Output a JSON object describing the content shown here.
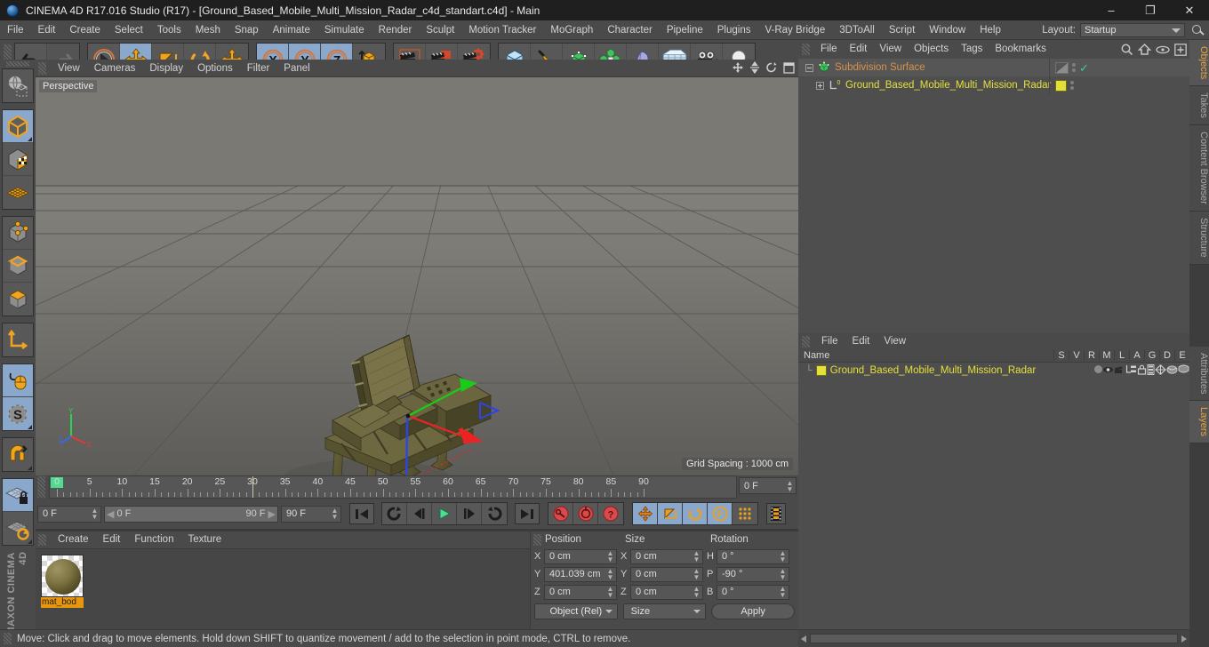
{
  "window": {
    "title": "CINEMA 4D R17.016 Studio (R17) - [Ground_Based_Mobile_Multi_Mission_Radar_c4d_standart.c4d] - Main",
    "minimize": "–",
    "maximize": "❐",
    "close": "✕"
  },
  "menubar": {
    "items": [
      "File",
      "Edit",
      "Create",
      "Select",
      "Tools",
      "Mesh",
      "Snap",
      "Animate",
      "Simulate",
      "Render",
      "Sculpt",
      "Motion Tracker",
      "MoGraph",
      "Character",
      "Pipeline",
      "Plugins",
      "V-Ray Bridge",
      "3DToAll",
      "Script",
      "Window",
      "Help"
    ],
    "layout_label": "Layout:",
    "layout_value": "Startup",
    "search_icon": "search-icon"
  },
  "toolbar": {
    "groups": [
      {
        "name": "history",
        "buttons": [
          {
            "name": "undo-button",
            "icon": "undo-icon",
            "active": false,
            "disabled": false
          },
          {
            "name": "redo-button",
            "icon": "redo-icon",
            "active": false,
            "disabled": true
          }
        ]
      },
      {
        "name": "transform",
        "buttons": [
          {
            "name": "live-selection-button",
            "icon": "cursor-circle-icon",
            "active": false,
            "disabled": false
          },
          {
            "name": "move-button",
            "icon": "move-icon",
            "active": true,
            "disabled": false
          },
          {
            "name": "scale-button",
            "icon": "scale-icon",
            "active": false,
            "disabled": false
          },
          {
            "name": "rotate-button",
            "icon": "rotate-icon",
            "active": false,
            "disabled": false
          },
          {
            "name": "drag-button",
            "icon": "move-alt-icon",
            "active": false,
            "disabled": false
          }
        ]
      },
      {
        "name": "axis-lock",
        "buttons": [
          {
            "name": "lock-x-button",
            "icon": "axis-x-icon",
            "active": true,
            "disabled": false
          },
          {
            "name": "lock-y-button",
            "icon": "axis-y-icon",
            "active": true,
            "disabled": false
          },
          {
            "name": "lock-z-button",
            "icon": "axis-z-icon",
            "active": true,
            "disabled": false
          },
          {
            "name": "world-object-coord-button",
            "icon": "world-axis-cube-icon",
            "active": false,
            "disabled": false
          }
        ]
      },
      {
        "name": "render",
        "buttons": [
          {
            "name": "render-view-button",
            "icon": "clapper-icon",
            "active": false,
            "disabled": false
          },
          {
            "name": "render-region-button",
            "icon": "clapper-region-icon",
            "active": false,
            "disabled": false
          },
          {
            "name": "render-settings-button",
            "icon": "clapper-gear-icon",
            "active": false,
            "disabled": false
          }
        ]
      },
      {
        "name": "objects",
        "buttons": [
          {
            "name": "add-cube-button",
            "icon": "cube-icon",
            "active": false,
            "disabled": false
          },
          {
            "name": "add-spline-button",
            "icon": "pen-spline-icon",
            "active": false,
            "disabled": false
          },
          {
            "name": "add-nurbs-button",
            "icon": "green-cube-icon",
            "active": false,
            "disabled": false
          },
          {
            "name": "add-array-button",
            "icon": "array-icon",
            "active": false,
            "disabled": false
          },
          {
            "name": "add-deformer-button",
            "icon": "bend-deformer-icon",
            "active": false,
            "disabled": false
          },
          {
            "name": "add-environment-button",
            "icon": "floor-grid-icon",
            "active": false,
            "disabled": false
          },
          {
            "name": "add-camera-button",
            "icon": "camera-icon",
            "active": false,
            "disabled": false
          },
          {
            "name": "add-light-button",
            "icon": "light-bulb-icon",
            "active": false,
            "disabled": false
          }
        ]
      }
    ]
  },
  "left_toolbar": {
    "groups": [
      {
        "buttons": [
          {
            "name": "make-editable-button",
            "icon": "make-editable-icon",
            "active": false
          }
        ]
      },
      {
        "buttons": [
          {
            "name": "model-mode-button",
            "icon": "model-cube-icon",
            "active": true
          },
          {
            "name": "texture-mode-button",
            "icon": "texture-cube-icon",
            "active": false
          },
          {
            "name": "uv-mesh-button",
            "icon": "uv-grid-icon",
            "active": false
          }
        ]
      },
      {
        "buttons": [
          {
            "name": "points-mode-button",
            "icon": "points-cube-icon",
            "active": false
          },
          {
            "name": "edges-mode-button",
            "icon": "edges-cube-icon",
            "active": false
          },
          {
            "name": "polygons-mode-button",
            "icon": "polygons-cube-icon",
            "active": false
          }
        ]
      },
      {
        "buttons": [
          {
            "name": "axis-modify-button",
            "icon": "axis-corner-icon",
            "active": false
          }
        ]
      },
      {
        "buttons": [
          {
            "name": "enable-tweak-button",
            "icon": "mouse-spline-icon",
            "active": true
          },
          {
            "name": "soft-selection-button",
            "icon": "soft-select-s-icon",
            "active": true
          }
        ]
      },
      {
        "buttons": [
          {
            "name": "snap-magnet-button",
            "icon": "magnet-icon",
            "active": false
          }
        ]
      },
      {
        "buttons": [
          {
            "name": "workplane-lock-button",
            "icon": "workplane-lock-icon",
            "active": true
          },
          {
            "name": "workplane-rotate-button",
            "icon": "workplane-rotate-icon",
            "active": false
          }
        ]
      }
    ],
    "brand_line1": "MAXON",
    "brand_line2": "CINEMA 4D"
  },
  "viewport": {
    "menu": [
      "View",
      "Cameras",
      "Display",
      "Options",
      "Filter",
      "Panel"
    ],
    "label": "Perspective",
    "grid_spacing": "Grid Spacing : 1000 cm",
    "axis_labels": {
      "x": "X",
      "y": "Y",
      "z": "Z"
    },
    "icons": [
      "move-view-icon",
      "pan-view-icon",
      "zoom-view-icon",
      "maximize-view-icon"
    ]
  },
  "timeline": {
    "ticks": [
      "0",
      "5",
      "10",
      "15",
      "20",
      "25",
      "30",
      "35",
      "40",
      "45",
      "50",
      "55",
      "60",
      "65",
      "70",
      "75",
      "80",
      "85",
      "90"
    ],
    "current_frame_right": "0 F",
    "current_frame": "0 F",
    "range_start": "0 F",
    "range_end": "90 F",
    "max_frame": "90 F",
    "buttons": [
      {
        "name": "go-to-start-button",
        "icon": "skip-start-icon",
        "active": false
      },
      {
        "name": "play-backwards-loop-button",
        "icon": "loop-icon",
        "active": false
      },
      {
        "name": "previous-frame-button",
        "icon": "step-back-icon",
        "active": false
      },
      {
        "name": "play-button",
        "icon": "play-icon",
        "active": false
      },
      {
        "name": "next-frame-button",
        "icon": "step-forward-icon",
        "active": false
      },
      {
        "name": "play-forward-loop-button",
        "icon": "loop-forward-icon",
        "active": false
      },
      {
        "name": "go-to-end-button",
        "icon": "skip-end-icon",
        "active": false
      },
      {
        "name": "record-key-button",
        "icon": "record-key-icon",
        "active": false
      },
      {
        "name": "autokey-button",
        "icon": "autokey-icon",
        "active": false
      },
      {
        "name": "keyframe-selection-button",
        "icon": "question-key-icon",
        "active": false
      },
      {
        "name": "key-position-button",
        "icon": "key-move-icon",
        "active": true
      },
      {
        "name": "key-scale-button",
        "icon": "key-scale-icon",
        "active": true
      },
      {
        "name": "key-rotation-button",
        "icon": "key-rotate-icon",
        "active": true
      },
      {
        "name": "key-param-button",
        "icon": "key-pla-icon",
        "active": true
      },
      {
        "name": "point-level-anim-button",
        "icon": "dots-grid-icon",
        "active": false
      },
      {
        "name": "timeline-filmstrip-button",
        "icon": "filmstrip-icon",
        "active": false
      }
    ]
  },
  "materials": {
    "menu": [
      "Create",
      "Edit",
      "Function",
      "Texture"
    ],
    "items": [
      {
        "name": "mat_bod",
        "swatch": "material-sphere-preview"
      }
    ]
  },
  "coordinates": {
    "headers": [
      "Position",
      "Size",
      "Rotation"
    ],
    "position": [
      {
        "axis": "X",
        "value": "0 cm"
      },
      {
        "axis": "Y",
        "value": "401.039 cm"
      },
      {
        "axis": "Z",
        "value": "0 cm"
      }
    ],
    "size": [
      {
        "axis": "X",
        "value": "0 cm"
      },
      {
        "axis": "Y",
        "value": "0 cm"
      },
      {
        "axis": "Z",
        "value": "0 cm"
      }
    ],
    "rotation": [
      {
        "axis": "H",
        "value": "0 °"
      },
      {
        "axis": "P",
        "value": "-90 °"
      },
      {
        "axis": "B",
        "value": "0 °"
      }
    ],
    "coord_system": "Object (Rel)",
    "size_mode": "Size",
    "apply_label": "Apply"
  },
  "objects_panel": {
    "menu": [
      "File",
      "Edit",
      "View",
      "Objects",
      "Tags",
      "Bookmarks"
    ],
    "tools": [
      "search-icon",
      "home-icon",
      "eye-icon",
      "plus-box-icon"
    ],
    "rows": [
      {
        "name": "Subdivision Surface",
        "color": "#d79348",
        "indent": 0,
        "icon": "subdivision-surface-icon",
        "selected": true
      },
      {
        "name": "Ground_Based_Mobile_Multi_Mission_Radar",
        "color": "#e3e03a",
        "indent": 1,
        "icon": "null-object-icon",
        "selected": false
      }
    ]
  },
  "layers_panel": {
    "menu": [
      "File",
      "Edit",
      "View"
    ],
    "columns": [
      "Name",
      "S",
      "V",
      "R",
      "M",
      "L",
      "A",
      "G",
      "D",
      "E"
    ],
    "rows": [
      {
        "name": "Ground_Based_Mobile_Multi_Mission_Radar",
        "color": "#e3e03a",
        "swatch": "#e3e03a"
      }
    ]
  },
  "vtabs_right": [
    {
      "label": "Objects",
      "active": true
    },
    {
      "label": "Takes",
      "active": false
    },
    {
      "label": "Content Browser",
      "active": false
    },
    {
      "label": "Structure",
      "active": false
    }
  ],
  "vtabs_right_lower": [
    {
      "label": "Attributes",
      "active": false
    },
    {
      "label": "Layers",
      "active": true
    }
  ],
  "statusbar": {
    "text": "Move: Click and drag to move elements. Hold down SHIFT to quantize movement / add to the selection in point mode, CTRL to remove."
  },
  "colors": {
    "accent_orange": "#e8960c",
    "active_blue": "#8aa8cc",
    "yellow": "#e3e03a",
    "green": "#4ddc90",
    "panel_bg": "#4a4a4a"
  }
}
